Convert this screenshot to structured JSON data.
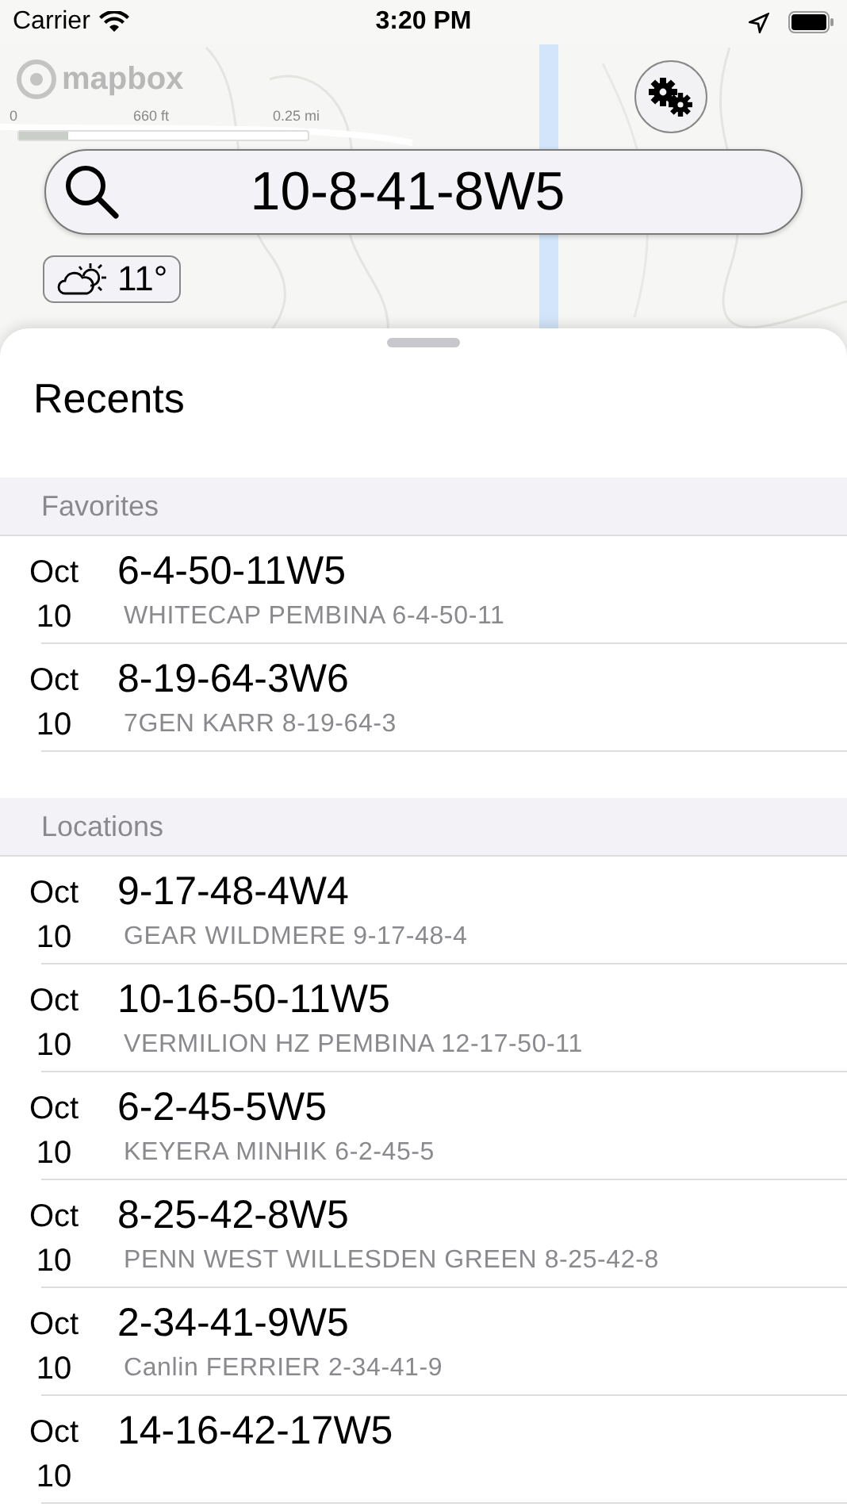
{
  "status_bar": {
    "carrier": "Carrier",
    "time": "3:20 PM"
  },
  "map": {
    "kind": "picture",
    "logo": "mapbox",
    "scale": {
      "start": "0",
      "feet": "660 ft",
      "miles": "0.25 mi",
      "level": 0.17
    }
  },
  "search": {
    "value": "10-8-41-8W5"
  },
  "weather": {
    "temperature": "11°"
  },
  "sheet": {
    "title": "Recents",
    "sections": [
      {
        "header": "Favorites",
        "rows": [
          {
            "month": "Oct",
            "day": "10",
            "title": "6-4-50-11W5",
            "subtitle": "WHITECAP PEMBINA 6-4-50-11"
          },
          {
            "month": "Oct",
            "day": "10",
            "title": "8-19-64-3W6",
            "subtitle": "7GEN KARR 8-19-64-3"
          }
        ]
      },
      {
        "header": "Locations",
        "rows": [
          {
            "month": "Oct",
            "day": "10",
            "title": "9-17-48-4W4",
            "subtitle": "GEAR WILDMERE 9-17-48-4"
          },
          {
            "month": "Oct",
            "day": "10",
            "title": "10-16-50-11W5",
            "subtitle": "VERMILION HZ PEMBINA 12-17-50-11"
          },
          {
            "month": "Oct",
            "day": "10",
            "title": "6-2-45-5W5",
            "subtitle": "KEYERA MINHIK 6-2-45-5"
          },
          {
            "month": "Oct",
            "day": "10",
            "title": "8-25-42-8W5",
            "subtitle": "PENN WEST WILLESDEN GREEN 8-25-42-8"
          },
          {
            "month": "Oct",
            "day": "10",
            "title": "2-34-41-9W5",
            "subtitle": "Canlin FERRIER 2-34-41-9"
          },
          {
            "month": "Oct",
            "day": "10",
            "title": "14-16-42-17W5"
          }
        ]
      }
    ]
  }
}
